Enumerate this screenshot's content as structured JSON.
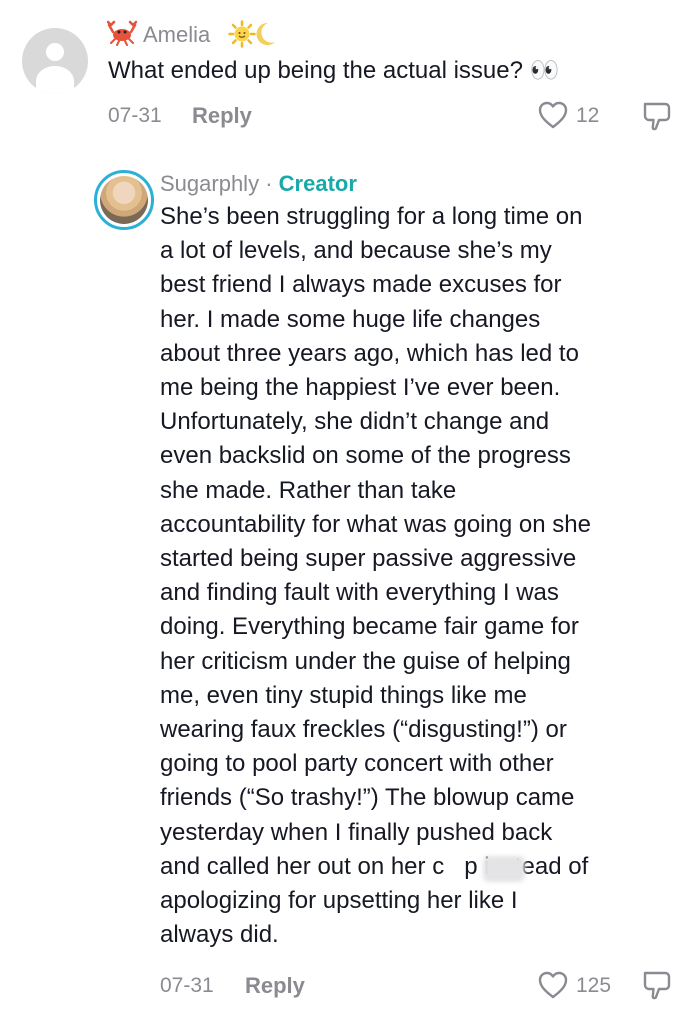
{
  "comment1": {
    "username": "Amelia",
    "badge_icons": [
      "crab-icon",
      "sun-icon",
      "moon-icon"
    ],
    "text": "What ended up being the actual issue? 👀",
    "date": "07-31",
    "reply_label": "Reply",
    "likes": "12"
  },
  "comment2": {
    "username": "Sugarphly",
    "separator": "·",
    "creator_label": "Creator",
    "lines": [
      "She’s been struggling for a long time on",
      "a lot of levels, and because she’s my",
      "best friend I always made excuses for",
      "her. I made some huge life changes",
      "about three years ago, which has led to",
      "me being the happiest I’ve ever been.",
      "Unfortunately, she didn’t change and",
      "even backslid on some of the progress",
      "she made. Rather than take",
      "accountability for what was going on she",
      "started being super passive aggressive",
      "and finding fault with everything I was",
      "doing. Everything became fair game for",
      "her criticism under the guise of helping",
      "me, even tiny stupid things like me",
      "wearing faux freckles (“disgusting!”) or",
      "going to pool party concert with other",
      "friends (“So trashy!”) The blowup came",
      "yesterday when I finally pushed back",
      "and called her out on her c   p instead of",
      "apologizing for upsetting her like I",
      "always did."
    ],
    "date": "07-31",
    "reply_label": "Reply",
    "likes": "125"
  },
  "colors": {
    "text": "#161823",
    "muted": "#8a8b91",
    "creator": "#1aa9a9",
    "avatar_ring": "#2bb0d6"
  }
}
